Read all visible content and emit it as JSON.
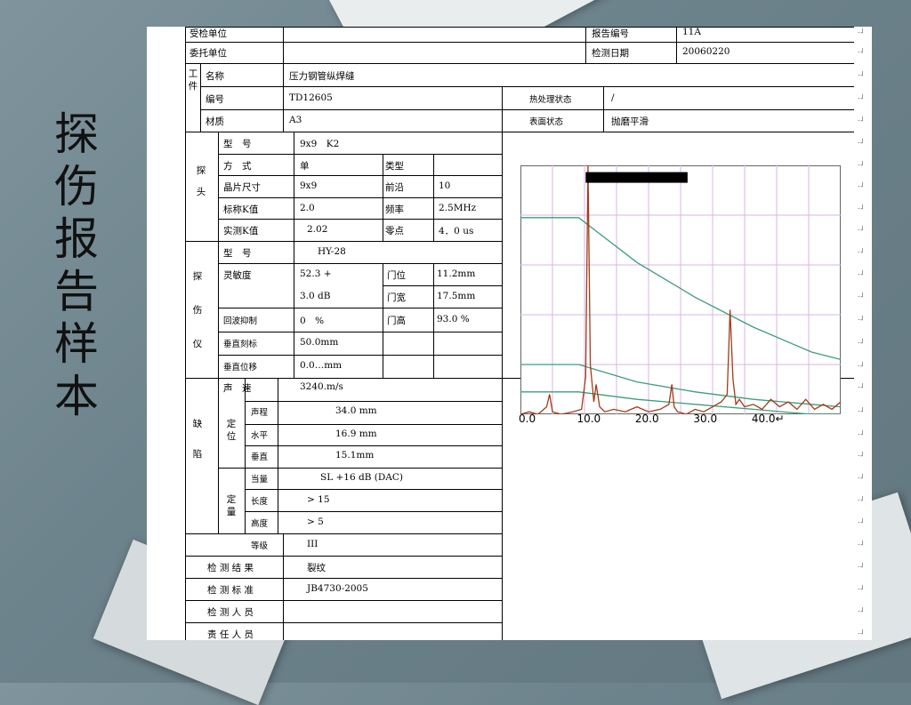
{
  "slide": {
    "title_chars": [
      "探",
      "伤",
      "报",
      "告",
      "样",
      "本"
    ]
  },
  "report": {
    "header": {
      "unit_label": "受检单位",
      "report_no_label": "报告编号",
      "report_no": "11A",
      "client_label": "委托单位",
      "date_label": "检测日期",
      "date": "20060220"
    },
    "workpiece": {
      "group_label": "工件",
      "name_label": "名称",
      "name": "压力钢管纵焊缝",
      "id_label": "编号",
      "id": "TD12605",
      "heat_label": "热处理状态",
      "heat": "/",
      "material_label": "材质",
      "material": "A3",
      "surface_label": "表面状态",
      "surface": "抛磨平滑"
    },
    "probe": {
      "group_label": "探头",
      "model_label": "型　号",
      "model": "9x9　K2",
      "mode_label": "方　式",
      "mode": "单",
      "type_label": "类型",
      "type": "",
      "chip_label": "晶片尺寸",
      "chip": "9x9",
      "front_label": "前沿",
      "front": "10",
      "k_nominal_label": "标称K值",
      "k_nominal": "2.0",
      "freq_label": "频率",
      "freq": "2.5MHz",
      "k_measured_label": "实测K值",
      "k_measured": "2.02",
      "zero_label": "零点",
      "zero": "4．0 us"
    },
    "instrument": {
      "group_label": "探伤仪",
      "model_label": "型　号",
      "model": "HY-28",
      "sensitivity_label": "灵敏度",
      "sensitivity_1": "52.3 +",
      "sensitivity_2": "3.0 dB",
      "gate_pos_label": "门位",
      "gate_pos": "11.2mm",
      "gate_width_label": "门宽",
      "gate_width": "17.5mm",
      "reject_label": "回波抑制",
      "reject": "0　%",
      "gate_height_label": "门高",
      "gate_height": "93.0 %",
      "vscale_label": "垂直刻标",
      "vscale": "50.0mm",
      "voffset_label": "垂直位移",
      "voffset": "0.0…mm",
      "velocity_label": "声　速",
      "velocity": "3240.m/s"
    },
    "defect": {
      "group_label": "缺陷",
      "locate_label": "定位",
      "path_label": "声程",
      "path": "34.0 mm",
      "horizontal_label": "水平",
      "horizontal": "16.9 mm",
      "vertical_label": "垂直",
      "vertical": "15.1mm",
      "equivalent_label": "当量",
      "equivalent": "SL +16 dB (DAC)",
      "quant_label": "定量",
      "length_label": "长度",
      "length": "> 15",
      "height_label": "高度",
      "height": "> 5",
      "grade_label": "等级",
      "grade": "III"
    },
    "footer": {
      "result_label": "检 测 结 果",
      "result": "裂纹",
      "standard_label": "检 测 标 准",
      "standard": "JB4730-2005",
      "inspector_label": "检 测 人 员",
      "inspector": "",
      "responsible_label": "责 任 人 员",
      "responsible": ""
    }
  },
  "chart_data": {
    "type": "line",
    "title": "",
    "x_ticks": [
      "0.0",
      "10.0",
      "20.0",
      "30.0",
      "40.0"
    ],
    "xlim": [
      0,
      55
    ],
    "ylim": [
      0,
      100
    ],
    "colors": {
      "waveform": "#a33a1a",
      "dac": "#3d9e78",
      "grid": "#d7b4e8",
      "gate": "#000000"
    },
    "gate": {
      "start": 11.2,
      "width": 17.5,
      "height_percent": 93.0
    },
    "series": [
      {
        "x": [
          0,
          1.5,
          3,
          4.5,
          5,
          5.5,
          7,
          9,
          10.5,
          11.2,
          11.6,
          12,
          12.6,
          13,
          13.6,
          14.5,
          16,
          18,
          20,
          22,
          24,
          25.5,
          26,
          26.4,
          27,
          28.5,
          30,
          31.5,
          33,
          34.5,
          35.5,
          36,
          36.5,
          37,
          37.6,
          38.5,
          40,
          41.5,
          43,
          44.5,
          46,
          47.5,
          49,
          50.5,
          52,
          53.5,
          55
        ],
        "y": [
          0,
          1,
          0,
          3,
          8,
          1,
          0,
          1,
          2,
          15,
          100,
          20,
          5,
          12,
          3,
          1,
          2,
          1,
          3,
          1,
          2,
          4,
          12,
          3,
          1,
          0,
          2,
          1,
          3,
          5,
          8,
          42,
          14,
          4,
          6,
          3,
          4,
          2,
          6,
          3,
          5,
          2,
          6,
          2,
          4,
          2,
          5
        ]
      },
      {
        "x": [
          0,
          10,
          20,
          30,
          40,
          50,
          55
        ],
        "y": [
          79,
          79,
          61,
          47,
          35,
          25,
          22
        ]
      },
      {
        "x": [
          0,
          10,
          20,
          30,
          40,
          50,
          55
        ],
        "y": [
          20,
          20,
          13,
          9,
          6,
          4,
          3
        ]
      },
      {
        "x": [
          0,
          10,
          20,
          30,
          40,
          50,
          55
        ],
        "y": [
          9,
          9,
          6,
          4,
          2,
          0,
          0
        ]
      }
    ]
  }
}
